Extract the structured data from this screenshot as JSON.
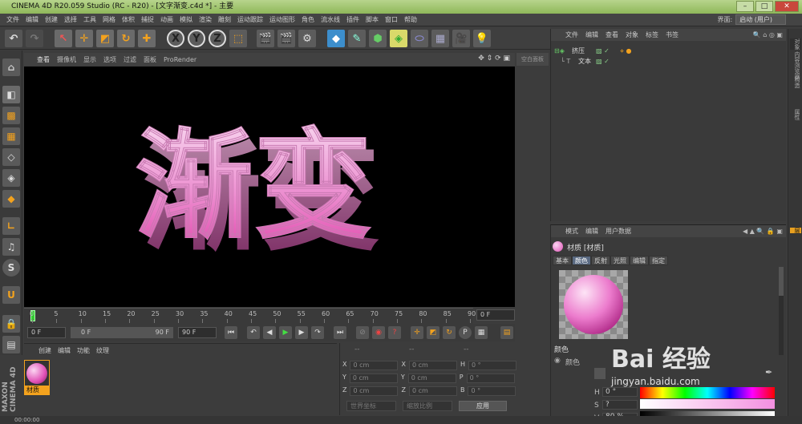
{
  "window": {
    "title": "CINEMA 4D R20.059 Studio (RC - R20) - [文字渐变.c4d *] - 主要"
  },
  "menu": [
    "文件",
    "编辑",
    "创建",
    "选择",
    "工具",
    "网格",
    "体积",
    "捕捉",
    "动画",
    "模拟",
    "渲染",
    "雕刻",
    "运动跟踪",
    "运动图形",
    "角色",
    "流水线",
    "插件",
    "脚本",
    "窗口",
    "帮助"
  ],
  "interface": {
    "label": "界面:",
    "value": "启动 (用户)"
  },
  "viewport": {
    "menu": [
      "查看",
      "摄像机",
      "显示",
      "选项",
      "过滤",
      "面板",
      "ProRender"
    ],
    "corner_label": "空白面板",
    "text3d": "渐变",
    "accent": "#e060a8"
  },
  "timeline": {
    "ticks": [
      "0",
      "5",
      "10",
      "15",
      "20",
      "25",
      "30",
      "35",
      "40",
      "45",
      "50",
      "55",
      "60",
      "65",
      "70",
      "75",
      "80",
      "85",
      "90"
    ],
    "current_frame": "0 F"
  },
  "transport": {
    "start": "0 F",
    "range_start": "0 F",
    "range_end": "90 F",
    "end": "90 F"
  },
  "material_panel": {
    "menu": [
      "创建",
      "编辑",
      "功能",
      "纹理"
    ],
    "material_name": "材质"
  },
  "coord_panel": {
    "headers": [
      "--",
      "--",
      "--"
    ],
    "rows": [
      {
        "a": "X",
        "av": "0 cm",
        "b": "X",
        "bv": "0 cm",
        "c": "H",
        "cv": "0 °"
      },
      {
        "a": "Y",
        "av": "0 cm",
        "b": "Y",
        "bv": "0 cm",
        "c": "P",
        "cv": "0 °"
      },
      {
        "a": "Z",
        "av": "0 cm",
        "b": "Z",
        "bv": "0 cm",
        "c": "B",
        "cv": "0 °"
      }
    ],
    "mode1": "世界坐标",
    "mode2": "缩放比例",
    "apply": "应用"
  },
  "object_manager": {
    "menu": [
      "文件",
      "编辑",
      "查看",
      "对象",
      "标签",
      "书签"
    ],
    "objects": [
      {
        "name": "挤压"
      },
      {
        "name": "文本"
      }
    ]
  },
  "attribute_manager": {
    "menu": [
      "模式",
      "编辑",
      "用户数据"
    ],
    "title": "材质 [材质]",
    "tabs": [
      "基本",
      "颜色",
      "反射",
      "光照",
      "编辑",
      "指定"
    ],
    "active_tab": "颜色",
    "section": "颜色",
    "color_label": "颜色",
    "hsv": [
      {
        "label": "H",
        "value": "0 °"
      },
      {
        "label": "S",
        "value": "?"
      },
      {
        "label": "V",
        "value": "80 %"
      }
    ]
  },
  "right_strip": [
    "对象",
    "内容浏览器",
    "构造",
    "属性",
    "层"
  ],
  "status": {
    "time": "00:00:00"
  },
  "watermark": {
    "brand": "Bai 经验",
    "url": "jingyan.baidu.com"
  }
}
